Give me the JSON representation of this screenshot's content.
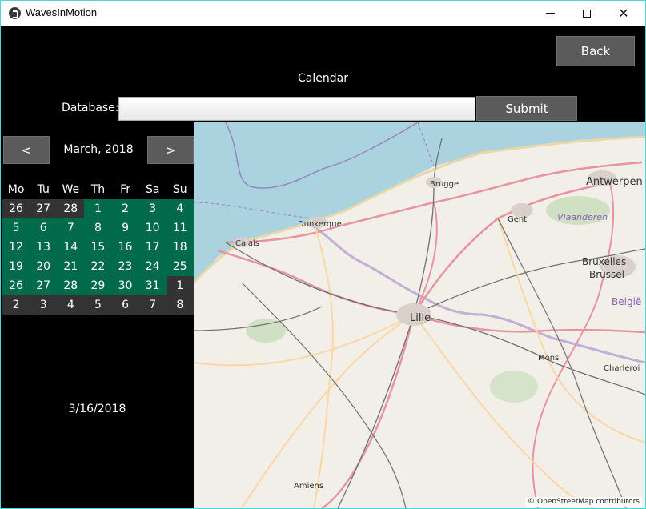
{
  "window": {
    "title": "WavesInMotion",
    "minimize": "—",
    "maximize": "☐",
    "close": "✕"
  },
  "header": {
    "back_label": "Back",
    "calendar_title": "Calendar"
  },
  "database": {
    "label": "Database:",
    "value": "",
    "placeholder": "",
    "submit_label": "Submit"
  },
  "calendar": {
    "prev_label": "<",
    "next_label": ">",
    "month_label": "March, 2018",
    "weekdays": [
      "Mo",
      "Tu",
      "We",
      "Th",
      "Fr",
      "Sa",
      "Su"
    ],
    "weeks": [
      [
        "26",
        "27",
        "28",
        "1",
        "2",
        "3",
        "4"
      ],
      [
        "5",
        "6",
        "7",
        "8",
        "9",
        "10",
        "11"
      ],
      [
        "12",
        "13",
        "14",
        "15",
        "16",
        "17",
        "18"
      ],
      [
        "19",
        "20",
        "21",
        "22",
        "23",
        "24",
        "25"
      ],
      [
        "26",
        "27",
        "28",
        "29",
        "30",
        "31",
        "1"
      ],
      [
        "2",
        "3",
        "4",
        "5",
        "6",
        "7",
        "8"
      ]
    ],
    "colors": {
      "in_month": "#006a4a",
      "out_month": "#333333"
    },
    "selected_date": "3/16/2018"
  },
  "map": {
    "places": [
      "Antwerpen",
      "Brugge",
      "Gent",
      "Vlaanderen",
      "Dunkerque",
      "Calais",
      "Bruxelles",
      "Brussel",
      "Lille",
      "België",
      "Mons",
      "Charleroi",
      "Amiens"
    ],
    "attribution": "© OpenStreetMap contributors"
  }
}
